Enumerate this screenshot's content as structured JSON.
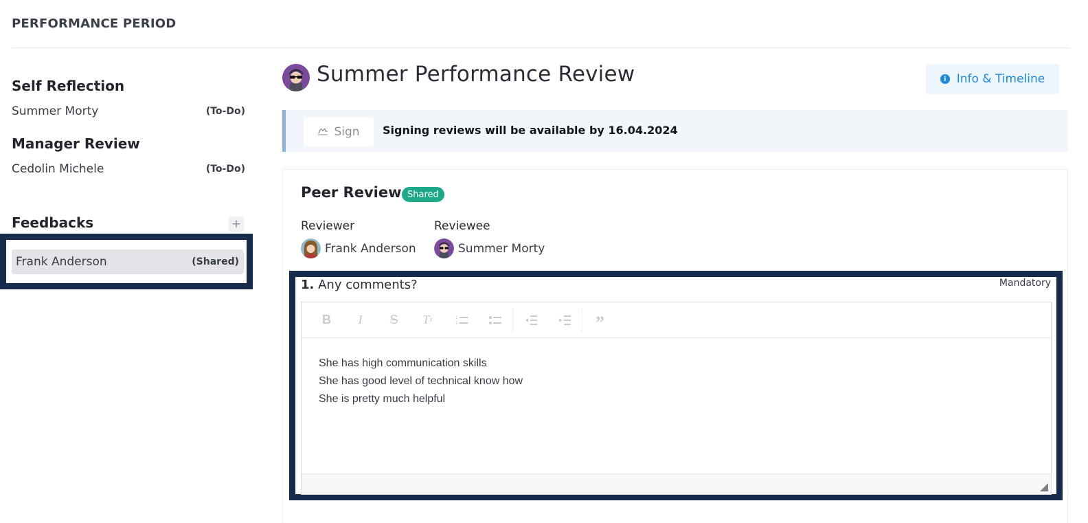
{
  "header": {
    "title": "PERFORMANCE PERIOD"
  },
  "sidebar": {
    "self_reflection": {
      "title": "Self Reflection",
      "name": "Summer Morty",
      "status": "(To-Do)"
    },
    "manager_review": {
      "title": "Manager Review",
      "name": "Cedolin Michele",
      "status": "(To-Do)"
    },
    "feedbacks": {
      "title": "Feedbacks",
      "add_label": "+",
      "items": [
        {
          "name": "Frank Anderson",
          "status": "(Shared)"
        }
      ]
    }
  },
  "main": {
    "title": "Summer Performance Review",
    "info_button": {
      "label": "Info & Timeline",
      "icon": "info-icon"
    },
    "sign_bar": {
      "button_label": "Sign",
      "button_icon": "signature-icon",
      "message": "Signing reviews will be available by 16.04.2024"
    },
    "peer_review": {
      "title": "Peer Review",
      "badge": "Shared",
      "reviewer_label": "Reviewer",
      "reviewer_name": "Frank Anderson",
      "reviewee_label": "Reviewee",
      "reviewee_name": "Summer Morty",
      "question": {
        "number": "1.",
        "text": "Any comments?",
        "requirement": "Mandatory"
      },
      "editor": {
        "toolbar": [
          "bold",
          "italic",
          "strikethrough",
          "remove-format",
          "numbered-list",
          "bulleted-list",
          "decrease-indent",
          "increase-indent",
          "blockquote"
        ],
        "lines": [
          "She has high communication skills",
          "She has good level of technical know how",
          "She is pretty much helpful"
        ]
      }
    }
  },
  "colors": {
    "accent": "#1e88e5",
    "badge": "#1ea88a",
    "highlight": "#172b4d"
  }
}
